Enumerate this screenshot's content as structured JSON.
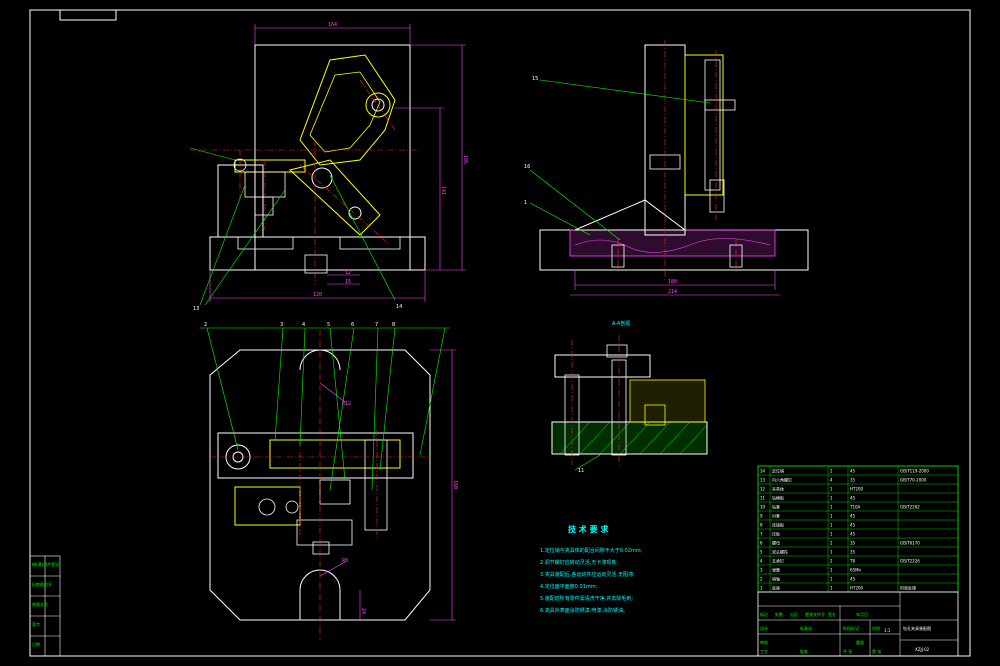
{
  "drawing": {
    "technical_requirements": {
      "heading": "技 术 要 求",
      "lines": [
        "1.定位销与夹具体的配合间隙不大于0.02mm;",
        "2.调节螺钉应转动灵活,无卡滞现象;",
        "3.夹具装配后,各运动件应运动灵活,无阻滞;",
        "4.定位面平面度0.01mm;",
        "5.装配前所有零件需清洗干净,并去除毛刺;",
        "6.夹具外表面涂防锈漆,喷漆,涂防锈油。"
      ]
    },
    "section_label": "A-A剖视",
    "dimensions": {
      "front_width": "164",
      "front_height": "185",
      "front_inner_height": "141",
      "base_width": "120",
      "small_a": "12",
      "small_b": "15",
      "side_inner_width": "180",
      "side_outer_width": "214",
      "bottom_radius_a": "R8",
      "bottom_radius_b": "R12",
      "plan_height": "160",
      "plan_radius": "R12",
      "plan_gap": "24"
    },
    "balloons": [
      "13",
      "14",
      "15",
      "16",
      "1",
      "2",
      "3",
      "4",
      "5",
      "6",
      "7",
      "8",
      "11"
    ],
    "title_block": {
      "drawing_name": "钻孔夹具装配图",
      "drawing_code": "XZJJ-02",
      "scale": "1:1",
      "labels": [
        "标记",
        "处数",
        "分区",
        "更改文件号",
        "签名",
        "年月日",
        "设计",
        "标准化",
        "审核",
        "工艺",
        "批准",
        "阶段标记",
        "重量",
        "比例",
        "共 张",
        "第 张"
      ]
    },
    "parts_list": [
      {
        "no": "14",
        "name": "定位销",
        "qty": "2",
        "mat": "45",
        "note": "GB/T119-2000"
      },
      {
        "no": "13",
        "name": "内六角螺钉",
        "qty": "4",
        "mat": "35",
        "note": "GB/T70-2000"
      },
      {
        "no": "12",
        "name": "夹具体",
        "qty": "1",
        "mat": "HT200",
        "note": ""
      },
      {
        "no": "11",
        "name": "钻模板",
        "qty": "1",
        "mat": "45",
        "note": ""
      },
      {
        "no": "10",
        "name": "钻套",
        "qty": "1",
        "mat": "T10A",
        "note": "GB/T2262"
      },
      {
        "no": "9",
        "name": "衬套",
        "qty": "1",
        "mat": "45",
        "note": ""
      },
      {
        "no": "8",
        "name": "连接板",
        "qty": "1",
        "mat": "45",
        "note": ""
      },
      {
        "no": "7",
        "name": "压板",
        "qty": "1",
        "mat": "45",
        "note": ""
      },
      {
        "no": "6",
        "name": "螺母",
        "qty": "2",
        "mat": "35",
        "note": "GB/T6170"
      },
      {
        "no": "5",
        "name": "双头螺柱",
        "qty": "1",
        "mat": "35",
        "note": ""
      },
      {
        "no": "4",
        "name": "支承钉",
        "qty": "2",
        "mat": "T8",
        "note": "GB/T2226"
      },
      {
        "no": "3",
        "name": "弹簧",
        "qty": "1",
        "mat": "65Mn",
        "note": ""
      },
      {
        "no": "2",
        "name": "销轴",
        "qty": "1",
        "mat": "45",
        "note": ""
      },
      {
        "no": "1",
        "name": "底座",
        "qty": "1",
        "mat": "HT200",
        "note": "时效处理"
      }
    ],
    "left_strip_labels": [
      "借(通)用件登记",
      "旧底图总号",
      "底图总号",
      "签字",
      "日期"
    ]
  }
}
